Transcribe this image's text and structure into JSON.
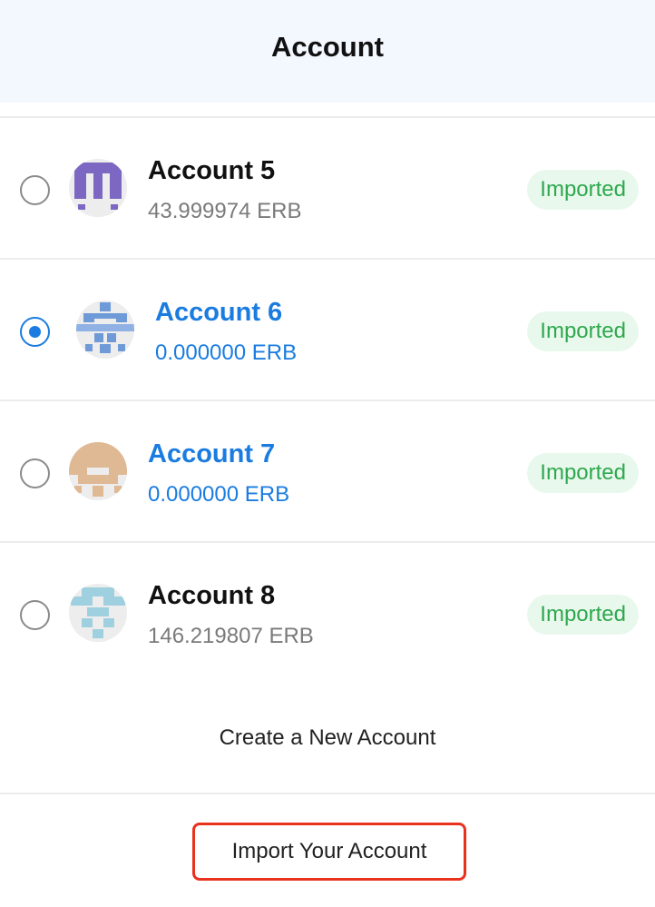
{
  "header": {
    "title": "Account"
  },
  "accounts": [
    {
      "name": "Account 5",
      "balance": "43.999974 ERB",
      "badge": "Imported",
      "selected": false,
      "active": false
    },
    {
      "name": "Account 6",
      "balance": "0.000000 ERB",
      "badge": "Imported",
      "selected": true,
      "active": true
    },
    {
      "name": "Account 7",
      "balance": "0.000000 ERB",
      "badge": "Imported",
      "selected": false,
      "active": true
    },
    {
      "name": "Account 8",
      "balance": "146.219807 ERB",
      "badge": "Imported",
      "selected": false,
      "active": false
    }
  ],
  "actions": {
    "create_label": "Create a New Account",
    "import_label": "Import Your Account"
  },
  "colors": {
    "header_bg": "#f3f8fe",
    "accent_blue": "#1a7ce0",
    "badge_green": "#2ea84e",
    "badge_bg": "#e9f8ec",
    "highlight_red": "#e8321e"
  },
  "icons": [
    "account-avatar-identicon",
    "radio-button"
  ]
}
